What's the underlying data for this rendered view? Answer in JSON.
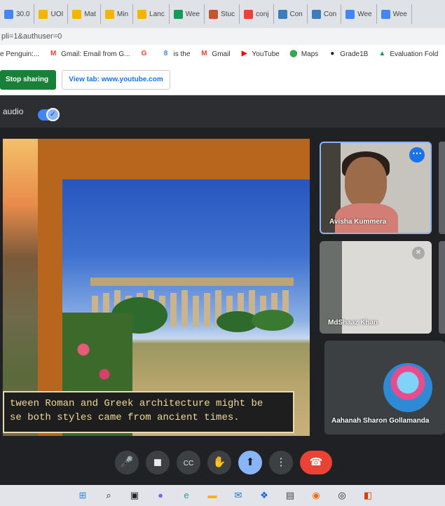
{
  "browser": {
    "tabs": [
      {
        "label": "30.0",
        "icon": "docs-icon",
        "color": "#4285f4"
      },
      {
        "label": "UOI",
        "icon": "bookmark-icon",
        "color": "#f4b400"
      },
      {
        "label": "Mat",
        "icon": "bookmark-icon",
        "color": "#f4b400"
      },
      {
        "label": "Min",
        "icon": "bookmark-icon",
        "color": "#f4b400"
      },
      {
        "label": "Lanc",
        "icon": "bookmark-icon",
        "color": "#f4b400"
      },
      {
        "label": "Wee",
        "icon": "drive-icon",
        "color": "#0f9d58"
      },
      {
        "label": "Stuc",
        "icon": "classroom-icon",
        "color": "#c5562c"
      },
      {
        "label": "conj",
        "icon": "google-icon",
        "color": "#ea4335"
      },
      {
        "label": "Con",
        "icon": "page-icon",
        "color": "#3b7bbf"
      },
      {
        "label": "Con",
        "icon": "page-icon",
        "color": "#3b7bbf"
      },
      {
        "label": "Wee",
        "icon": "docs-icon",
        "color": "#4285f4"
      },
      {
        "label": "Wee",
        "icon": "docs-icon",
        "color": "#4285f4"
      }
    ],
    "address": "pli=1&authuser=0",
    "bookmarks": [
      {
        "label": "e Penguin:...",
        "icon": "",
        "color": ""
      },
      {
        "label": "Gmail: Email from G...",
        "icon": "gmail-icon",
        "color": "#ea4335",
        "glyph": "M"
      },
      {
        "label": "",
        "icon": "google-icon",
        "color": "#ea4335",
        "glyph": "G"
      },
      {
        "label": "is the",
        "icon": "bookmark-icon",
        "color": "#4285f4",
        "glyph": "8"
      },
      {
        "label": "Gmail",
        "icon": "gmail-icon",
        "color": "#ea4335",
        "glyph": "M"
      },
      {
        "label": "YouTube",
        "icon": "youtube-icon",
        "color": "#ff0000",
        "glyph": "▶"
      },
      {
        "label": "Maps",
        "icon": "maps-icon",
        "color": "#34a853",
        "glyph": "⬤"
      },
      {
        "label": "Grade1B",
        "icon": "bookmark-icon",
        "color": "#222222",
        "glyph": "●"
      },
      {
        "label": "Evaluation Fold",
        "icon": "drive-icon",
        "color": "#0f9d58",
        "glyph": "▲"
      }
    ]
  },
  "sharing": {
    "stop_label": "Stop sharing",
    "view_tab_label": "View tab: www.youtube.com"
  },
  "meet": {
    "audio_label": "audio",
    "caption_lines": [
      "tween Roman and Greek architecture might be",
      "se both styles came from ancient times."
    ],
    "participants": [
      {
        "name": "Avisha Kummera"
      },
      {
        "name": "MdShaaz Khan"
      },
      {
        "name": "Aahanah Sharon Gollamanda"
      }
    ],
    "controls": [
      {
        "name": "microphone",
        "glyph": "🎤"
      },
      {
        "name": "camera",
        "glyph": "◼"
      },
      {
        "name": "captions",
        "glyph": "CC"
      },
      {
        "name": "raise-hand",
        "glyph": "✋"
      },
      {
        "name": "present",
        "glyph": "⬆"
      },
      {
        "name": "more-options",
        "glyph": "⋮"
      },
      {
        "name": "end-call",
        "glyph": "☎"
      }
    ],
    "accent": "#8ab4f8",
    "end_color": "#ea4335"
  },
  "taskbar": [
    {
      "icon": "windows-icon",
      "color": "#1e88e5",
      "glyph": "⊞"
    },
    {
      "icon": "search-icon",
      "color": "#222222",
      "glyph": "⌕"
    },
    {
      "icon": "task-view-icon",
      "color": "#222222",
      "glyph": "▣"
    },
    {
      "icon": "chat-icon",
      "color": "#7b61ff",
      "glyph": "●"
    },
    {
      "icon": "edge-icon",
      "color": "#1ba1a1",
      "glyph": "e"
    },
    {
      "icon": "file-explorer-icon",
      "color": "#f5b400",
      "glyph": "▬"
    },
    {
      "icon": "mail-icon",
      "color": "#1976d2",
      "glyph": "✉"
    },
    {
      "icon": "dropbox-icon",
      "color": "#0061fe",
      "glyph": "❖"
    },
    {
      "icon": "store-icon",
      "color": "#444444",
      "glyph": "▤"
    },
    {
      "icon": "brave-icon",
      "color": "#f56a00",
      "glyph": "◉"
    },
    {
      "icon": "obs-icon",
      "color": "#222222",
      "glyph": "◎"
    },
    {
      "icon": "office-icon",
      "color": "#d83b01",
      "glyph": "◧"
    }
  ]
}
